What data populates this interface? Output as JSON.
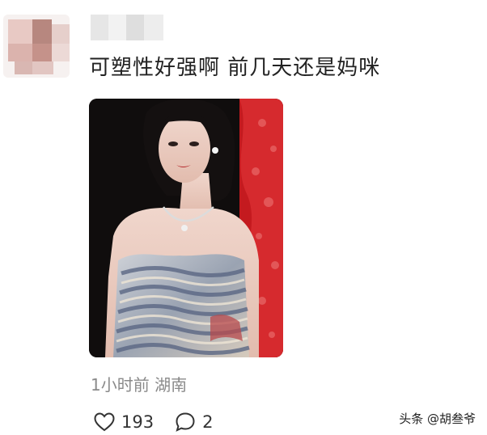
{
  "comment": {
    "text": "可塑性好强啊 前几天还是妈咪",
    "meta": "1小时前 湖南",
    "likes": "193",
    "replies": "2",
    "like_icon": "heart-icon",
    "reply_icon": "comment-bubble-icon"
  },
  "watermark": "头条 @胡叁爷"
}
